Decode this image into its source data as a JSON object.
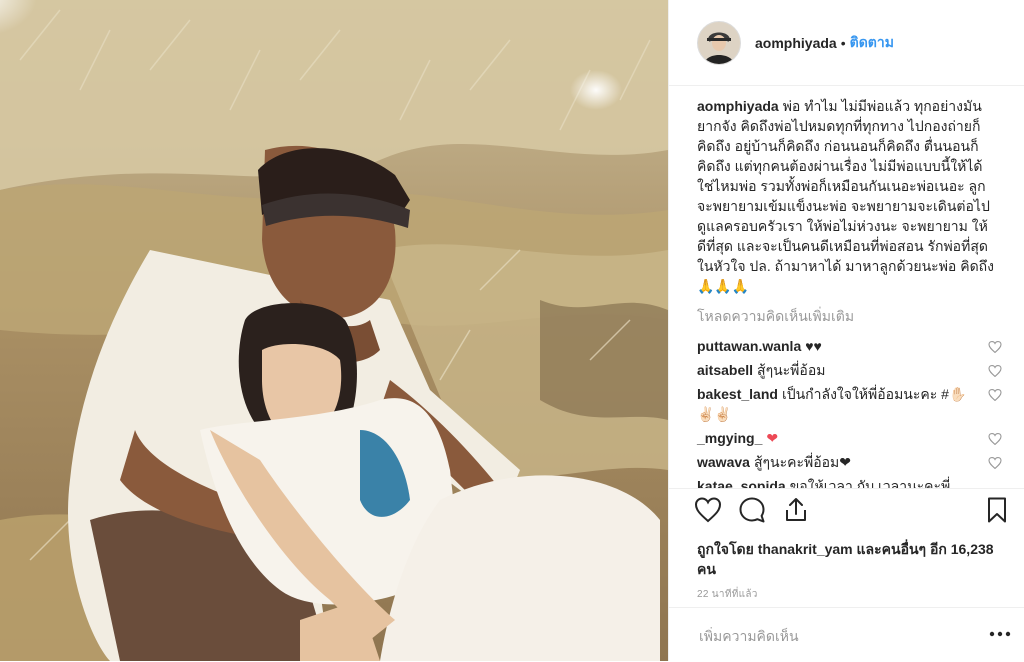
{
  "header": {
    "username": "aomphiyada",
    "separator": "•",
    "follow_label": "ติดตาม",
    "avatar_icon": "profile-avatar"
  },
  "caption": {
    "username": "aomphiyada",
    "text": "พ่อ ทำไม ไม่มีพ่อแล้ว ทุกอย่างมันยากจัง คิดถึงพ่อไปหมดทุกที่ทุกทาง ไปกองถ่ายก็คิดถึง อยู่บ้านก็คิดถึง ก่อนนอนก็คิดถึง ตื่นนอนก็คิดถึง แต่ทุกคนต้องผ่านเรื่อง ไม่มีพ่อแบบนี้ให้ได้ใช่ไหมพ่อ รวมทั้งพ่อก็เหมือนกันเนอะพ่อเนอะ ลูกจะพยายามเข้มแข็งนะพ่อ จะพยายามจะเดินต่อไป ดูแลครอบครัวเรา ให้พ่อไม่ห่วงนะ จะพยายาม ให้ดีที่สุด และจะเป็นคนดีเหมือนที่พ่อสอน รักพ่อที่สุดในหัวใจ ปล. ถ้ามาหาได้ มาหาลูกด้วยนะพ่อ คิดถึง 🙏🙏🙏"
  },
  "load_more_label": "โหลดความคิดเห็นเพิ่มเติม",
  "comments": [
    {
      "username": "puttawan.wanla",
      "text": "♥♥"
    },
    {
      "username": "aitsabell",
      "text": "สู้ๆนะพี่อ้อม"
    },
    {
      "username": "bakest_land",
      "text": "เป็นกำลังใจให้พี่อ้อมนะคะ #✋🏻✌🏻✌🏻"
    },
    {
      "username": "_mgying_",
      "text": "❤"
    },
    {
      "username": "wawava",
      "text": "สู้ๆนะคะพี่อ้อม❤"
    },
    {
      "username": "katae_sopida",
      "text": "ขอให้เวลา กับ เวลานะคะพี่"
    }
  ],
  "actions": {
    "like_icon": "heart-outline-icon",
    "comment_icon": "comment-bubble-icon",
    "share_icon": "share-upload-icon",
    "save_icon": "bookmark-icon"
  },
  "likes_text": "ถูกใจโดย thanakrit_yam และคนอื่นๆ อีก 16,238 คน",
  "timestamp": "22 นาทีที่แล้ว",
  "add_comment_placeholder": "เพิ่มความคิดเห็น",
  "more_options_icon": "more-dots-icon",
  "colors": {
    "link_blue": "#3897f0",
    "text": "#262626",
    "muted": "#999999",
    "red_heart": "#ed4956"
  }
}
